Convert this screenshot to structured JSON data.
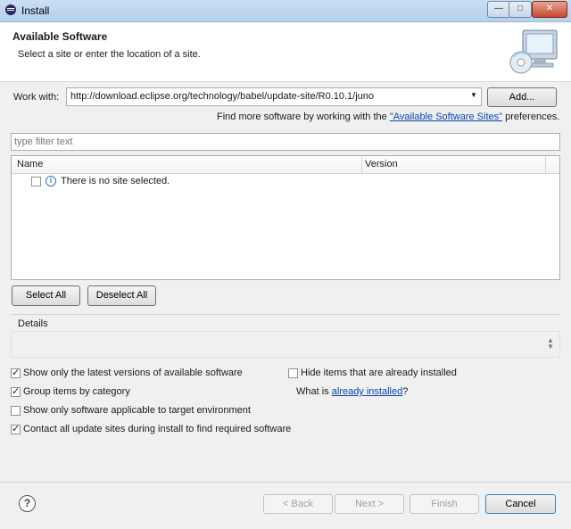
{
  "window": {
    "title": "Install",
    "minimize": "—",
    "maximize": "□",
    "close": "✕"
  },
  "header": {
    "title": "Available Software",
    "subtitle": "Select a site or enter the location of a site."
  },
  "work_with": {
    "label": "Work with:",
    "value": "http://download.eclipse.org/technology/babel/update-site/R0.10.1/juno",
    "add_label": "Add...",
    "more_prefix": "Find more software by working with the ",
    "more_link": "\"Available Software Sites\"",
    "more_suffix": " preferences."
  },
  "filter": {
    "placeholder": "type filter text"
  },
  "table": {
    "columns": [
      "Name",
      "Version"
    ],
    "row_text": "There is no site selected."
  },
  "buttons": {
    "select_all": "Select All",
    "deselect_all": "Deselect All"
  },
  "details": {
    "label": "Details"
  },
  "options": {
    "latest_versions": {
      "label": "Show only the latest versions of available software",
      "checked": true
    },
    "group_by_category": {
      "label": "Group items by category",
      "checked": true
    },
    "target_env": {
      "label": "Show only software applicable to target environment",
      "checked": false
    },
    "contact_sites": {
      "label": "Contact all update sites during install to find required software",
      "checked": true
    },
    "hide_installed": {
      "label": "Hide items that are already installed",
      "checked": false
    },
    "what_is_prefix": "What is ",
    "what_is_link": "already installed",
    "what_is_suffix": "?"
  },
  "footer": {
    "back": "< Back",
    "next": "Next >",
    "finish": "Finish",
    "cancel": "Cancel"
  },
  "colors": {
    "link": "#0645ad",
    "header_bg": "#ffffff",
    "titlebar": "#c9dff4"
  }
}
